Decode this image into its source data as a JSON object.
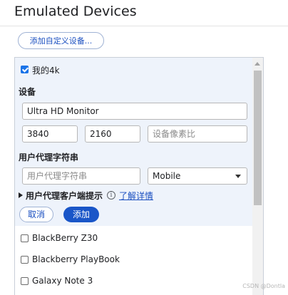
{
  "panel": {
    "title": "Emulated Devices",
    "add_custom_label": "添加自定义设备..."
  },
  "editor": {
    "device_name": "我的4k",
    "device_checked": true,
    "device_section_label": "设备",
    "name_value": "Ultra HD Monitor",
    "width_value": "3840",
    "height_value": "2160",
    "dpr_placeholder": "设备像素比",
    "ua_section_label": "用户代理字符串",
    "ua_placeholder": "用户代理字符串",
    "ua_type_value": "Mobile",
    "client_hints_label": "用户代理客户端提示",
    "info_glyph": "i",
    "learn_more_label": "了解详情",
    "cancel_label": "取消",
    "add_label": "添加"
  },
  "devices": [
    {
      "label": "BlackBerry Z30",
      "checked": false
    },
    {
      "label": "Blackberry PlayBook",
      "checked": false
    },
    {
      "label": "Galaxy Note 3",
      "checked": false
    }
  ],
  "watermark": "CSDN @Dontla",
  "colors": {
    "accent": "#1a56c8",
    "link": "#1a4fc0",
    "editor_bg": "#eef3fb",
    "checkbox_checked": "#1a73e8"
  }
}
